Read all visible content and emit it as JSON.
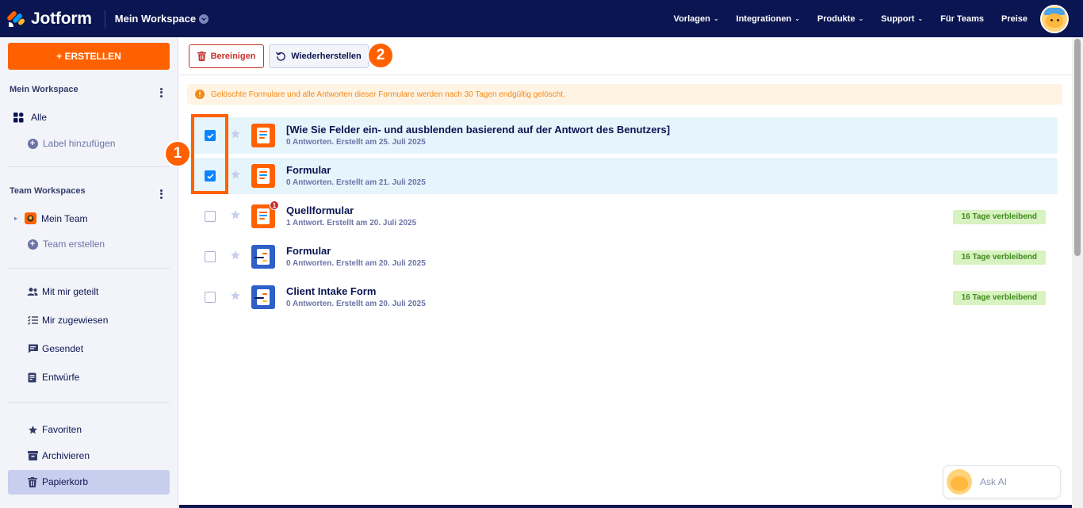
{
  "header": {
    "logo_text": "Jotform",
    "workspace_label": "Mein Workspace",
    "nav": [
      {
        "label": "Vorlagen",
        "chevron": true
      },
      {
        "label": "Integrationen",
        "chevron": true
      },
      {
        "label": "Produkte",
        "chevron": true
      },
      {
        "label": "Support",
        "chevron": true
      },
      {
        "label": "Für Teams",
        "chevron": false
      },
      {
        "label": "Preise",
        "chevron": false
      }
    ]
  },
  "sidebar": {
    "create_label": "+ ERSTELLEN",
    "my_workspace_title": "Mein Workspace",
    "all_label": "Alle",
    "add_label": "Label hinzufügen",
    "team_workspaces_title": "Team Workspaces",
    "my_team_label": "Mein Team",
    "create_team_label": "Team erstellen",
    "shared_label": "Mit mir geteilt",
    "assigned_label": "Mir zugewiesen",
    "sent_label": "Gesendet",
    "drafts_label": "Entwürfe",
    "favorites_label": "Favoriten",
    "archive_label": "Archivieren",
    "trash_label": "Papierkorb"
  },
  "toolbar": {
    "clean_label": "Bereinigen",
    "restore_label": "Wiederherstellen"
  },
  "notice": "Gelöschte Formulare und alle Antworten dieser Formulare werden nach 30 Tagen endgültig gelöscht.",
  "forms": [
    {
      "title": "[Wie Sie Felder ein- und ausblenden basierend auf der Antwort des Benutzers]",
      "meta": "0 Antworten. Erstellt am 25. Juli 2025",
      "selected": true,
      "days": "",
      "icon": "orange",
      "badge": ""
    },
    {
      "title": "Formular",
      "meta": "0 Antworten. Erstellt am 21. Juli 2025",
      "selected": true,
      "days": "",
      "icon": "orange",
      "badge": ""
    },
    {
      "title": "Quellformular",
      "meta": "1 Antwort. Erstellt am 20. Juli 2025",
      "selected": false,
      "days": "16 Tage verbleibend",
      "icon": "orange",
      "badge": "1"
    },
    {
      "title": "Formular",
      "meta": "0 Antworten. Erstellt am 20. Juli 2025",
      "selected": false,
      "days": "16 Tage verbleibend",
      "icon": "blue",
      "badge": ""
    },
    {
      "title": "Client Intake Form",
      "meta": "0 Antworten. Erstellt am 20. Juli 2025",
      "selected": false,
      "days": "16 Tage verbleibend",
      "icon": "blue",
      "badge": ""
    }
  ],
  "annotations": {
    "step1": "1",
    "step2": "2"
  },
  "ask_ai_label": "Ask AI",
  "colors": {
    "brand_navy": "#0a1551",
    "accent_orange": "#ff6100",
    "danger_red": "#c9302c",
    "selected_row": "#e6f4fc",
    "checkbox_blue": "#0a84ff",
    "days_badge": "#d8f2c2"
  }
}
